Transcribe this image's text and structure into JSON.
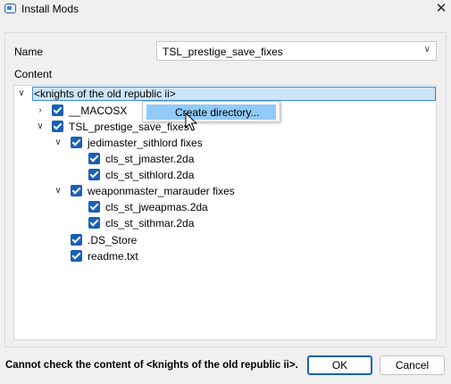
{
  "window": {
    "title": "Install Mods",
    "close_glyph": "✕",
    "icon": "app-icon"
  },
  "form": {
    "name_label": "Name",
    "name_value": "TSL_prestige_save_fixes",
    "content_label": "Content"
  },
  "tree": {
    "root": "<knights of the old republic ii>",
    "items": [
      {
        "label": "__MACOSX",
        "checked": true,
        "expander": "collapsed"
      },
      {
        "label": "TSL_prestige_save_fixes",
        "checked": true,
        "expander": "expanded"
      },
      {
        "label": "jedimaster_sithlord fixes",
        "checked": true,
        "expander": "expanded"
      },
      {
        "label": "cls_st_jmaster.2da",
        "checked": true
      },
      {
        "label": "cls_st_sithlord.2da",
        "checked": true
      },
      {
        "label": "weaponmaster_marauder fixes",
        "checked": true,
        "expander": "expanded"
      },
      {
        "label": "cls_st_jweapmas.2da",
        "checked": true
      },
      {
        "label": "cls_st_sithmar.2da",
        "checked": true
      },
      {
        "label": ".DS_Store",
        "checked": true
      },
      {
        "label": "readme.txt",
        "checked": true
      }
    ]
  },
  "context_menu": {
    "item": "Create directory..."
  },
  "status": "Cannot check the content of <knights of the old republic ii>.",
  "buttons": {
    "ok": "OK",
    "cancel": "Cancel"
  },
  "colors": {
    "accent": "#1a5fb4",
    "selection": "#cce4f7",
    "menu_highlight": "#91c9f7"
  }
}
